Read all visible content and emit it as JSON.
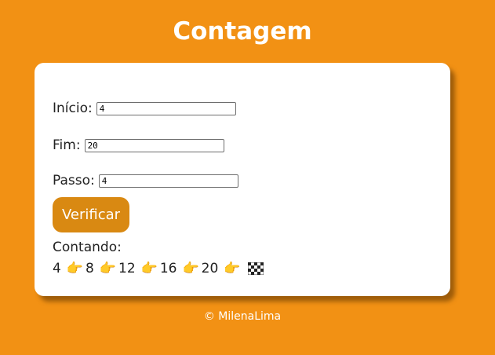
{
  "page": {
    "title": "Contagem",
    "background_color": "#F29114",
    "footer": "© MilenaLima"
  },
  "form": {
    "inicio": {
      "label": "Início:",
      "value": "4"
    },
    "fim": {
      "label": "Fim:",
      "value": "20"
    },
    "passo": {
      "label": "Passo:",
      "value": "4"
    },
    "button": {
      "label": "Verificar",
      "color": "#D98912"
    }
  },
  "result": {
    "label": "Contando:",
    "sequence": [
      "4",
      "8",
      "12",
      "16",
      "20"
    ],
    "separator_icon": "pointing-hand-icon",
    "end_icon": "checkered-flag-icon"
  }
}
